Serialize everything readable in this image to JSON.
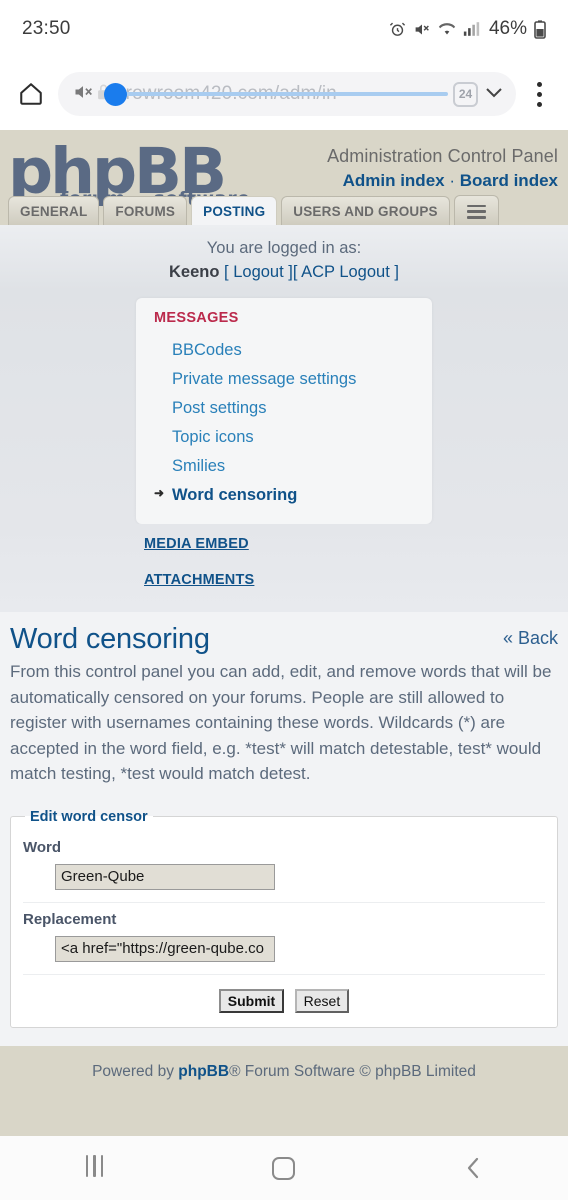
{
  "status_bar": {
    "time": "23:50",
    "battery_percent": "46%",
    "icons": [
      "alarm-icon",
      "mute-icon",
      "wifi-icon",
      "signal-icon",
      "battery-icon"
    ]
  },
  "browser": {
    "home_icon": "home-icon",
    "mute_icon": "sound-off-icon",
    "lock_icon": "lock-icon",
    "url": "growroom420.com/adm/in",
    "tab_count": "24",
    "chevron_icon": "chevron-down-icon",
    "menu_icon": "kebab-menu-icon"
  },
  "acp_header": {
    "logo_main": "phpBB",
    "logo_sub_forum": "forum",
    "logo_sub_software": "software",
    "logo_reg": "®",
    "title": "Administration Control Panel",
    "admin_index": "Admin index",
    "separator": "·",
    "board_index": "Board index"
  },
  "tabs": [
    {
      "label": "GENERAL",
      "active": false
    },
    {
      "label": "FORUMS",
      "active": false
    },
    {
      "label": "POSTING",
      "active": true
    },
    {
      "label": "USERS AND GROUPS",
      "active": false
    }
  ],
  "tab_menu_icon": "hamburger-menu-icon",
  "login": {
    "line1": "You are logged in as:",
    "username": "Keeno",
    "logout": "[ Logout ]",
    "acp_logout": "[ ACP Logout ]"
  },
  "menu": {
    "heading": "MESSAGES",
    "items": [
      {
        "label": "BBCodes",
        "active": false
      },
      {
        "label": "Private message settings",
        "active": false
      },
      {
        "label": "Post settings",
        "active": false
      },
      {
        "label": "Topic icons",
        "active": false
      },
      {
        "label": "Smilies",
        "active": false
      },
      {
        "label": "Word censoring",
        "active": true
      }
    ]
  },
  "subcategories": [
    {
      "label": "MEDIA EMBED"
    },
    {
      "label": "ATTACHMENTS"
    }
  ],
  "page": {
    "title": "Word censoring",
    "back_label": "« Back",
    "description": "From this control panel you can add, edit, and remove words that will be automatically censored on your forums. People are still allowed to register with usernames containing these words. Wildcards (*) are accepted in the word field, e.g. *test* will match detestable, test* would match testing, *test would match detest."
  },
  "form": {
    "legend": "Edit word censor",
    "word_label": "Word",
    "word_value": "Green-Qube",
    "replacement_label": "Replacement",
    "replacement_value": "<a href=\"https://green-qube.co",
    "submit_label": "Submit",
    "reset_label": "Reset"
  },
  "footer": {
    "powered_prefix": "Powered by ",
    "brand": "phpBB",
    "powered_suffix": "® Forum Software © phpBB Limited"
  },
  "android_nav": {
    "recents_icon": "recents-icon",
    "home_icon": "home-square-icon",
    "back_icon": "back-chevron-icon"
  },
  "colors": {
    "acp_bar": "#d9d6c8",
    "link_blue": "#105289",
    "menu_blue": "#2980b9",
    "heading_red": "#bb2a4c",
    "progress_blue": "#1a7ced",
    "body_text": "#5c6a7c"
  }
}
